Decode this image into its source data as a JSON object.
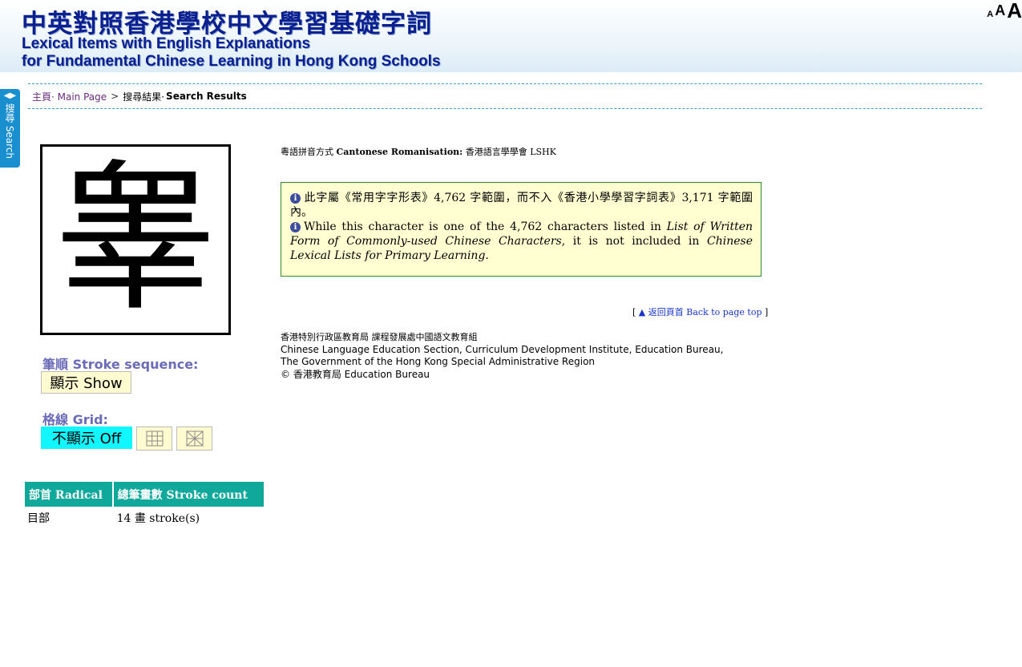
{
  "header": {
    "title_zh": "中英對照香港學校中文學習基礎字詞",
    "title_en_line1": "Lexical Items with English Explanations",
    "title_en_line2": "for Fundamental Chinese Learning in Hong Kong Schools",
    "font_size_small": "A",
    "font_size_medium": "A",
    "font_size_large": "A"
  },
  "side_tab": {
    "label": "搜尋 Search",
    "icon": "left-right-arrows-icon",
    "color": "#1a8fd0"
  },
  "breadcrumb": {
    "home_label": "主頁· Main Page",
    "separator": ">",
    "current_zh": "搜尋結果·",
    "current_en": "Search Results"
  },
  "character": {
    "glyph": "睾"
  },
  "stroke_sequence": {
    "label": "筆順 Stroke sequence:",
    "show_button": "顯示 Show"
  },
  "grid": {
    "label": "格線 Grid:",
    "off_button": "不顯示 Off",
    "grid_options": [
      "square-grid-icon",
      "diagonal-grid-icon"
    ],
    "active_color": "#12f7ff"
  },
  "radical_table": {
    "headers": [
      "部首 Radical",
      "總筆畫數 Stroke count"
    ],
    "rows": [
      [
        "目部",
        "14 畫 stroke(s)"
      ]
    ],
    "header_color": "#0fa89b"
  },
  "romanisation": {
    "prefix": "粵語拼音方式",
    "label": "Cantonese Romanisation:",
    "value": "香港語言學學會 LSHK"
  },
  "notice": {
    "zh_text": "此字屬《常用字字形表》4,762 字範圍，而不入《香港小學學習字詞表》3,171 字範圍內。",
    "en_part1": "While this character is one of the 4,762 characters listed in",
    "en_title1": "List of Written Form of Commonly-used Chinese Characters",
    "en_part2": ", it is not included in",
    "en_title2": "Chinese Lexical Lists for Primary Learning",
    "en_part3": "."
  },
  "back_to_top": {
    "open_bracket": "[",
    "link_text": "▲ 返回頁首 Back to page top",
    "close_bracket": "]"
  },
  "footer": {
    "line1": "香港特別行政區教育局 課程發展處中國語文教育組",
    "line2": "Chinese Language Education Section, Curriculum Development Institute, Education Bureau,",
    "line3": "The Government of the Hong Kong Special Administrative Region",
    "line4": "© 香港教育局 Education Bureau"
  }
}
